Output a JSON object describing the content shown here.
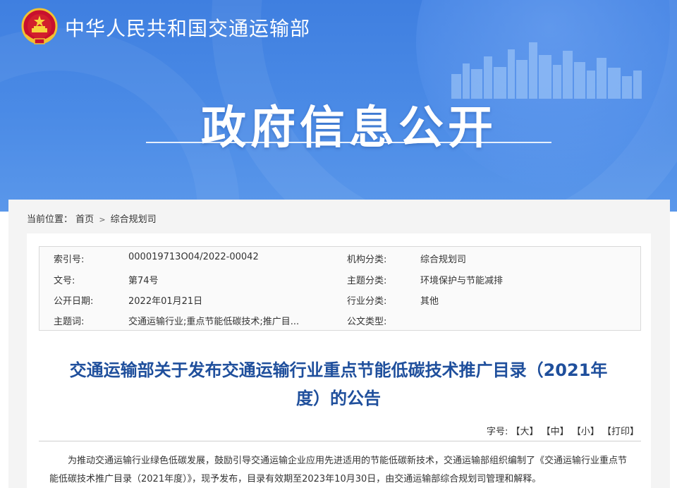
{
  "header": {
    "ministry_name": "中华人民共和国交通运输部",
    "section_title": "政府信息公开",
    "emblem_icon": "national-emblem-icon",
    "brand_color": "#4a89e5"
  },
  "breadcrumb": {
    "label": "当前位置：",
    "home": "首页",
    "separator": ">",
    "current": "综合规划司"
  },
  "meta": {
    "rows": [
      {
        "l1": "索引号:",
        "v1": "000019713O04/2022-00042",
        "l2": "机构分类:",
        "v2": "综合规划司"
      },
      {
        "l1": "文号:",
        "v1": "第74号",
        "l2": "主题分类:",
        "v2": "环境保护与节能减排"
      },
      {
        "l1": "公开日期:",
        "v1": "2022年01月21日",
        "l2": "行业分类:",
        "v2": "其他"
      },
      {
        "l1": "主题词:",
        "v1": "交通运输行业;重点节能低碳技术;推广目...",
        "l2": "公文类型:",
        "v2": ""
      }
    ]
  },
  "article": {
    "title_line1": "交通运输部关于发布交通运输行业重点节能低碳技术推广目录（2021年",
    "title_line2": "度）的公告",
    "title_color": "#1f4f9c",
    "font_size_label": "字号:",
    "font_large": "【大】",
    "font_medium": "【中】",
    "font_small": "【小】",
    "print": "【打印】",
    "body": "为推动交通运输行业绿色低碳发展，鼓励引导交通运输企业应用先进适用的节能低碳新技术，交通运输部组织编制了《交通运输行业重点节能低碳技术推广目录（2021年度）》，现予发布，目录有效期至2023年10月30日，由交通运输部综合规划司管理和解释。"
  }
}
